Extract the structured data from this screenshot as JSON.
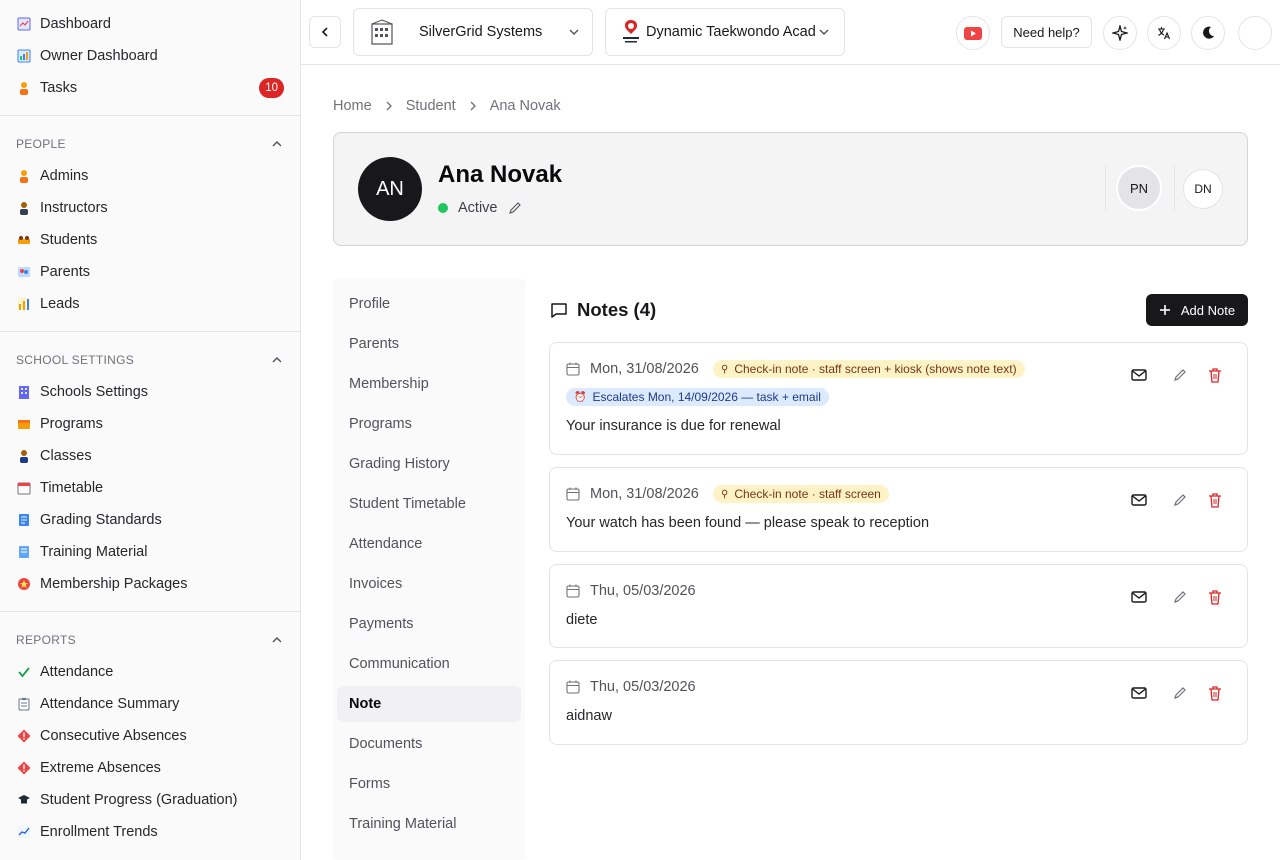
{
  "sidebar": {
    "top_items": [
      {
        "label": "Dashboard",
        "icon": "dashboard-icon"
      },
      {
        "label": "Owner Dashboard",
        "icon": "chart-icon"
      },
      {
        "label": "Tasks",
        "icon": "person-icon",
        "badge": "10"
      }
    ],
    "people": {
      "title": "PEOPLE",
      "items": [
        {
          "label": "Admins",
          "icon": "person-icon"
        },
        {
          "label": "Instructors",
          "icon": "teacher-icon"
        },
        {
          "label": "Students",
          "icon": "students-icon"
        },
        {
          "label": "Parents",
          "icon": "family-icon"
        },
        {
          "label": "Leads",
          "icon": "bar-chart-icon"
        }
      ]
    },
    "school_settings": {
      "title": "SCHOOL SETTINGS",
      "items": [
        {
          "label": "Schools Settings",
          "icon": "building-icon"
        },
        {
          "label": "Programs",
          "icon": "programs-icon"
        },
        {
          "label": "Classes",
          "icon": "classes-icon"
        },
        {
          "label": "Timetable",
          "icon": "calendar-icon"
        },
        {
          "label": "Grading Standards",
          "icon": "document-icon"
        },
        {
          "label": "Training Material",
          "icon": "book-icon"
        },
        {
          "label": "Membership Packages",
          "icon": "star-badge-icon"
        }
      ]
    },
    "reports": {
      "title": "REPORTS",
      "items": [
        {
          "label": "Attendance",
          "icon": "check-icon"
        },
        {
          "label": "Attendance Summary",
          "icon": "clipboard-icon"
        },
        {
          "label": "Consecutive Absences",
          "icon": "warning-diamond-icon"
        },
        {
          "label": "Extreme Absences",
          "icon": "warning-diamond-icon"
        },
        {
          "label": "Student Progress (Graduation)",
          "icon": "graduation-cap-icon"
        },
        {
          "label": "Enrollment Trends",
          "icon": "trend-icon"
        }
      ]
    }
  },
  "topbar": {
    "company": "SilverGrid Systems",
    "school": "Dynamic Taekwondo Acad",
    "help_label": "Need help?"
  },
  "breadcrumb": [
    "Home",
    "Student",
    "Ana Novak"
  ],
  "profile": {
    "initials": "AN",
    "name": "Ana Novak",
    "status": "Active",
    "linked": [
      "PN",
      "DN"
    ]
  },
  "tabs": [
    "Profile",
    "Parents",
    "Membership",
    "Programs",
    "Grading History",
    "Student Timetable",
    "Attendance",
    "Invoices",
    "Payments",
    "Communication",
    "Note",
    "Documents",
    "Forms",
    "Training Material"
  ],
  "active_tab": "Note",
  "notes": {
    "title": "Notes (4)",
    "add_label": "Add Note",
    "items": [
      {
        "date": "Mon, 31/08/2026",
        "tag": "Check-in note · staff screen + kiosk (shows note text)",
        "escalation": "Escalates Mon, 14/09/2026 — task + email",
        "text": "Your insurance is due for renewal"
      },
      {
        "date": "Mon, 31/08/2026",
        "tag": "Check-in note · staff screen",
        "text": "Your watch has been found — please speak to reception"
      },
      {
        "date": "Thu, 05/03/2026",
        "text": "diete"
      },
      {
        "date": "Thu, 05/03/2026",
        "text": "aidnaw"
      }
    ]
  },
  "colors": {
    "accent": "#18181b",
    "badge": "#dc2626",
    "active": "#22c55e",
    "delete": "#dc2626",
    "tag_amber": "#fef3c7",
    "tag_blue": "#dbeafe"
  }
}
